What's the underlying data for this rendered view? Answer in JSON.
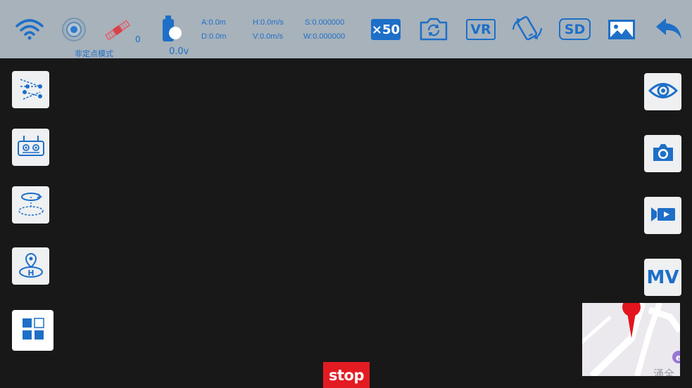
{
  "status_bar": {
    "satellite_count": "0",
    "mode_label": "非定点模式",
    "battery_voltage": "0.0v",
    "telemetry": {
      "altitude": "A:0.0m",
      "distance": "D:0.0m",
      "h_speed": "H:0.0m/s",
      "v_speed": "V:0.0m/s",
      "s_value": "S:0.000000",
      "w_value": "W:0.000000"
    },
    "zoom_label": "×50",
    "vr_label": "VR",
    "sd_label": "SD"
  },
  "right_panel": {
    "mv_label": "MV"
  },
  "map": {
    "place_label": "涌全"
  },
  "stop_button": {
    "label": "stop"
  },
  "colors": {
    "accent": "#1e6fc7",
    "topbar": "#a7b2bb",
    "stop": "#e31b23",
    "pin": "#e3141c"
  },
  "icons": [
    "wifi-icon",
    "gimbal-icon",
    "satellite-icon",
    "battery-icon",
    "zoom-icon",
    "camera-switch-icon",
    "vr-icon",
    "phone-rotate-icon",
    "sd-card-icon",
    "gallery-icon",
    "back-icon",
    "waypoint-icon",
    "remote-controller-icon",
    "orbit-icon",
    "return-home-icon",
    "grid-menu-icon",
    "eye-icon",
    "photo-camera-icon",
    "video-camera-icon",
    "mv-icon",
    "map-pin-icon"
  ]
}
